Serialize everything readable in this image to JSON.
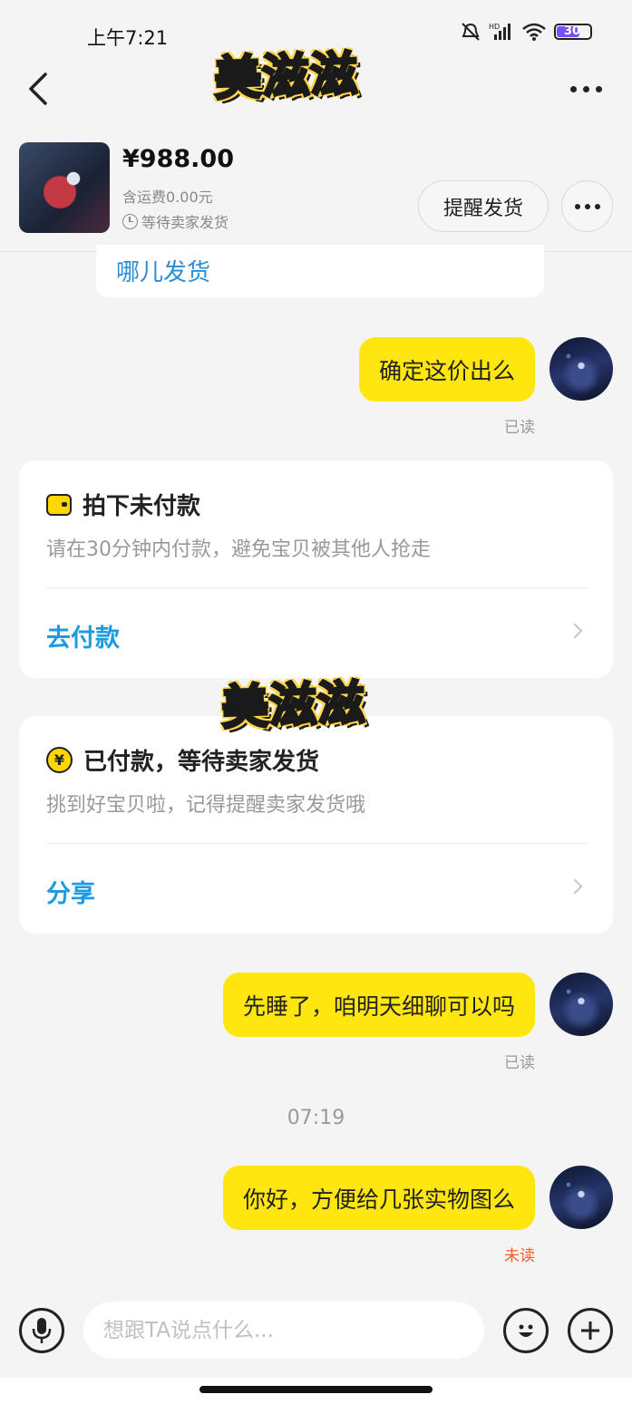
{
  "status_bar": {
    "time": "上午7:21",
    "battery": "30",
    "network_label": "HD"
  },
  "header": {
    "logo_text": "美滋滋"
  },
  "product": {
    "price": "¥988.00",
    "shipping": "含运费0.00元",
    "status": "等待卖家发货",
    "remind_button": "提醒发货"
  },
  "messages": {
    "partial_text": "哪儿发货",
    "msg1": {
      "text": "确定这价出么",
      "read": "已读"
    },
    "msg2": {
      "text": "先睡了，咱明天细聊可以吗",
      "read": "已读"
    },
    "time_sep": "07:19",
    "msg3": {
      "text": "你好，方便给几张实物图么",
      "read": "未读"
    }
  },
  "cards": {
    "unpaid": {
      "title": "拍下未付款",
      "subtitle": "请在30分钟内付款，避免宝贝被其他人抢走",
      "action": "去付款"
    },
    "paid": {
      "title": "已付款，等待卖家发货",
      "subtitle": "挑到好宝贝啦，记得提醒卖家发货哦",
      "action": "分享"
    }
  },
  "watermark": {
    "text": "美滋滋"
  },
  "input": {
    "placeholder": "想跟TA说点什么..."
  },
  "icons": [
    "back-icon",
    "more-icon",
    "clock-icon",
    "wallet-icon",
    "yen-icon",
    "chevron-right-icon",
    "mic-icon",
    "emoji-icon",
    "plus-icon"
  ],
  "colors": {
    "bubble": "#ffe60f",
    "link": "#1e9be0",
    "unread": "#ff5a1f",
    "background": "#f4f4f4"
  }
}
